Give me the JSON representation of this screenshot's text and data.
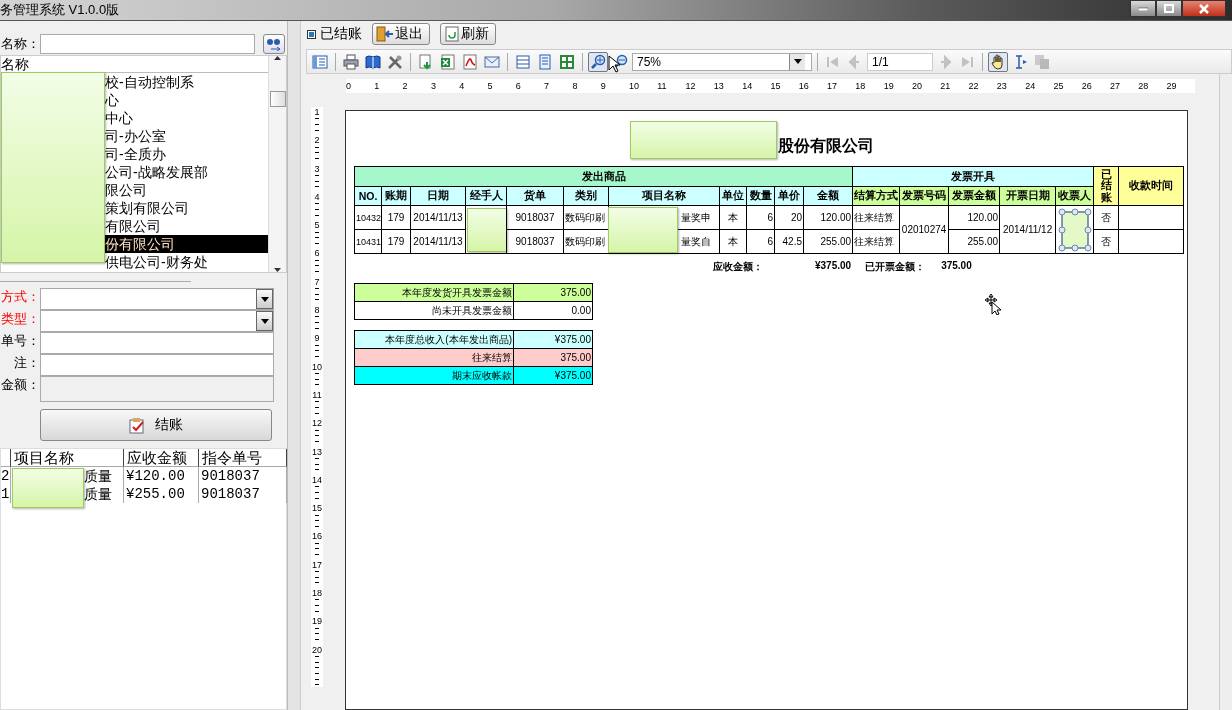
{
  "window": {
    "title": "务管理系统 V1.0.0版"
  },
  "left": {
    "search_label": "名称：",
    "list": {
      "header": "名称",
      "items": [
        {
          "label": "校-自动控制系",
          "selected": false
        },
        {
          "label": "心",
          "selected": false
        },
        {
          "label": "中心",
          "selected": false
        },
        {
          "label": "司-办公室",
          "selected": false
        },
        {
          "label": "司-全质办",
          "selected": false
        },
        {
          "label": "公司-战略发展部",
          "selected": false
        },
        {
          "label": "限公司",
          "selected": false
        },
        {
          "label": "策划有限公司",
          "selected": false
        },
        {
          "label": "有限公司",
          "selected": false
        },
        {
          "label": "份有限公司",
          "selected": true
        },
        {
          "label": "供电公司-财务处",
          "selected": false
        }
      ]
    },
    "form": [
      {
        "label": "方式：",
        "kind": "combo",
        "required": true
      },
      {
        "label": "类型：",
        "kind": "combo",
        "required": true
      },
      {
        "label": "单号：",
        "kind": "text",
        "required": false
      },
      {
        "label": "注：",
        "kind": "text",
        "required": false
      },
      {
        "label": "金额：",
        "kind": "readonly",
        "required": false
      }
    ],
    "settle_button": "结账",
    "grid": {
      "columns": [
        "",
        "项目名称",
        "应收金额",
        "指令单号"
      ],
      "rows": [
        [
          "2",
          "质量",
          "¥120.00",
          "9018037"
        ],
        [
          "1",
          "质量",
          "¥255.00",
          "9018037"
        ]
      ]
    }
  },
  "top": {
    "settled_checkbox": {
      "label": "已结账",
      "checked": true
    },
    "buttons": [
      "退出",
      "刷新"
    ]
  },
  "toolbar": {
    "zoom": "75%",
    "page": "1/1",
    "buttons": [
      {
        "selected": false,
        "disabled": false
      },
      {
        "selected": false,
        "disabled": false
      },
      {
        "selected": false,
        "disabled": false
      },
      {
        "selected": false,
        "disabled": false
      },
      {
        "selected": false,
        "disabled": false
      },
      {
        "selected": false,
        "disabled": false
      },
      {
        "selected": false,
        "disabled": false
      },
      {
        "selected": false,
        "disabled": false
      },
      {
        "selected": false,
        "disabled": false
      },
      {
        "selected": false,
        "disabled": false
      },
      {
        "selected": false,
        "disabled": false
      },
      {
        "selected": true,
        "disabled": false
      },
      {
        "selected": false,
        "disabled": false
      },
      {
        "selected": false,
        "disabled": true
      },
      {
        "selected": false,
        "disabled": true
      },
      {
        "selected": false,
        "disabled": true
      },
      {
        "selected": false,
        "disabled": true
      },
      {
        "selected": true,
        "disabled": false
      },
      {
        "selected": false,
        "disabled": false
      },
      {
        "selected": false,
        "disabled": true
      }
    ]
  },
  "ruler": {
    "horizontal": [
      "0",
      "1",
      "2",
      "3",
      "4",
      "5",
      "6",
      "7",
      "8",
      "9",
      "10",
      "11",
      "12",
      "13",
      "14",
      "15",
      "16",
      "17",
      "18",
      "19",
      "20",
      "21",
      "22",
      "23",
      "24",
      "25",
      "26",
      "27",
      "28",
      "29"
    ],
    "vertical": [
      "1",
      "2",
      "3",
      "4",
      "5",
      "6",
      "7",
      "8",
      "9",
      "10",
      "11",
      "12",
      "13",
      "14",
      "15",
      "16",
      "17",
      "18",
      "19",
      "20"
    ]
  },
  "report": {
    "title": "股份有限公司",
    "group_headers": [
      "发出商品",
      "发票开具"
    ],
    "side_headers": [
      "已结账",
      "收款时间"
    ],
    "columns": [
      "NO.",
      "账期",
      "日期",
      "经手人",
      "货单",
      "类别",
      "项目名称",
      "单位",
      "数量",
      "单价",
      "金额",
      "结算方式",
      "发票号码",
      "发票金额",
      "开票日期",
      "收票人"
    ],
    "invoice_no": "02010274",
    "invoice_date": "2014/11/12",
    "rows": [
      {
        "no": "10432",
        "period": "179",
        "date": "2014/11/13",
        "bill": "9018037",
        "category": "数码印刷",
        "project": "量奖申",
        "unit": "本",
        "qty": "6",
        "price": "20",
        "amount": "120.00",
        "settlement": "往来结算",
        "invoice_amount": "120.00",
        "settled": "否"
      },
      {
        "no": "10431",
        "period": "179",
        "date": "2014/11/13",
        "bill": "9018037",
        "category": "数码印刷",
        "project": "量奖自",
        "unit": "本",
        "qty": "6",
        "price": "42.5",
        "amount": "255.00",
        "settlement": "往来结算",
        "invoice_amount": "255.00",
        "settled": "否"
      }
    ],
    "totals": {
      "receivable_label": "应收金额：",
      "receivable": "¥375.00",
      "invoiced_label": "已开票金额：",
      "invoiced": "375.00"
    },
    "summary_tables": [
      [
        {
          "label": "本年度发货开具发票金额",
          "value": "375.00",
          "color": "#ccff99"
        },
        {
          "label": "尚未开具发票金额",
          "value": "0.00",
          "color": "#ffffff"
        }
      ],
      [
        {
          "label": "本年度总收入(本年发出商品)",
          "value": "¥375.00",
          "color": "#ccffff"
        },
        {
          "label": "往来结算",
          "value": "375.00",
          "color": "#ffcccc"
        },
        {
          "label": "期末应收帐款",
          "value": "¥375.00",
          "color": "#00ffff"
        }
      ]
    ]
  }
}
